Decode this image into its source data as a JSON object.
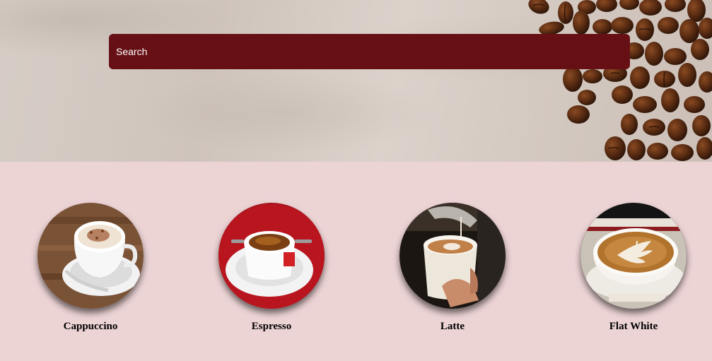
{
  "search": {
    "placeholder": "Search"
  },
  "header": {
    "background_image": "coffee-beans-on-concrete"
  },
  "menu": {
    "items": [
      {
        "name": "Cappuccino",
        "image": "cappuccino-cup-image"
      },
      {
        "name": "Espresso",
        "image": "espresso-cup-image"
      },
      {
        "name": "Latte",
        "image": "latte-pour-image"
      },
      {
        "name": "Flat White",
        "image": "flat-white-latte-art-image"
      }
    ]
  },
  "colors": {
    "search_background": "#661015",
    "page_background": "#ecd3d4"
  }
}
